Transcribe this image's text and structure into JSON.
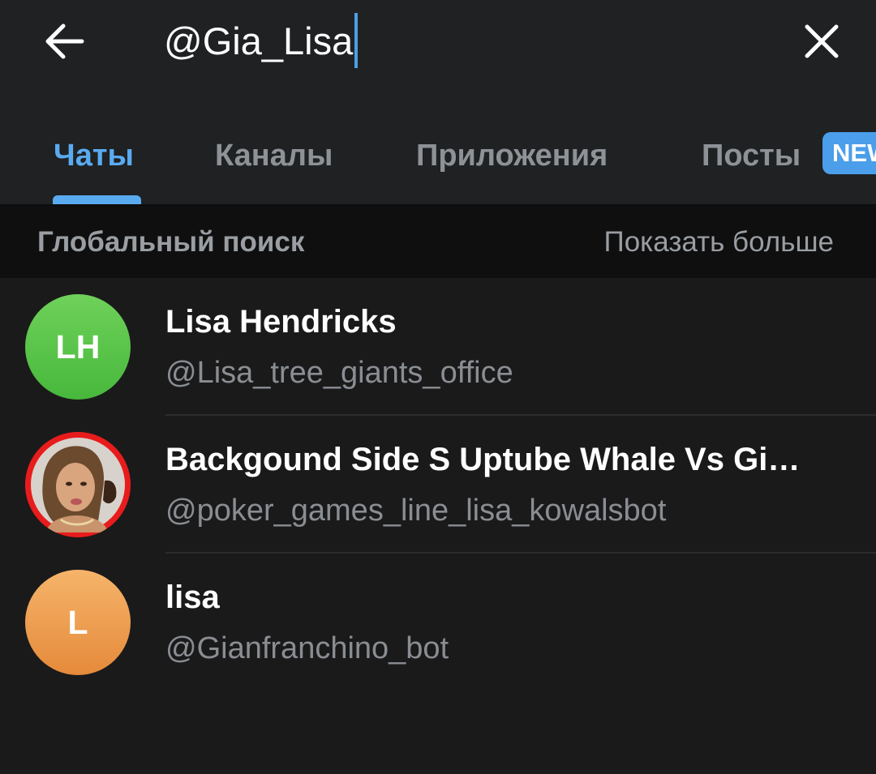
{
  "header": {
    "back_icon": "arrow-left-icon",
    "search_value": "@Gia_Lisa",
    "close_icon": "close-icon"
  },
  "tabs": [
    {
      "label": "Чаты",
      "active": true
    },
    {
      "label": "Каналы",
      "active": false
    },
    {
      "label": "Приложения",
      "active": false
    },
    {
      "label": "Посты",
      "active": false,
      "badge": "NEW"
    }
  ],
  "section": {
    "title": "Глобальный поиск",
    "more": "Показать больше"
  },
  "results": [
    {
      "name": "Lisa Hendricks",
      "handle": "@Lisa_tree_giants_office",
      "avatar_initials": "LH",
      "avatar_color": "#52c046"
    },
    {
      "name": "Backgound Side S Uptube Whale Vs Gi…",
      "handle": "@poker_games_line_lisa_kowalsbot",
      "avatar_initials": "",
      "avatar_color": "#e81c1c"
    },
    {
      "name": "lisa",
      "handle": "@Gianfranchino_bot",
      "avatar_initials": "L",
      "avatar_color": "#ec9a4a"
    }
  ],
  "colors": {
    "accent": "#5aaaf0",
    "badge": "#4a9eea",
    "background": "#1a1a1b",
    "header_background": "#1f2123"
  }
}
